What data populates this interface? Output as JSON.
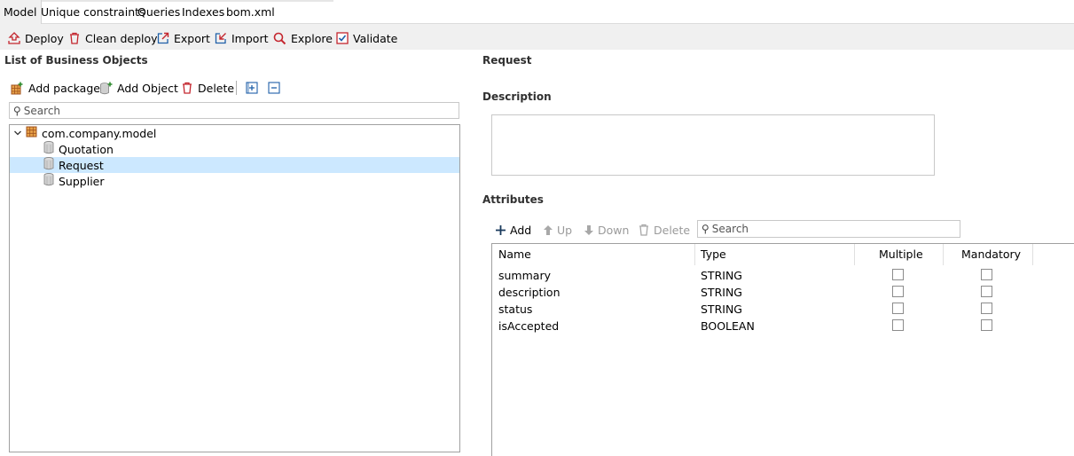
{
  "tabs": [
    {
      "label": "Model",
      "active": true
    },
    {
      "label": "Unique constraints",
      "active": false
    },
    {
      "label": "Queries",
      "active": false
    },
    {
      "label": "Indexes",
      "active": false
    },
    {
      "label": "bom.xml",
      "active": false
    }
  ],
  "toolbar": {
    "deploy": "Deploy",
    "clean_deploy": "Clean deploy",
    "export": "Export",
    "import": "Import",
    "explore": "Explore",
    "validate": "Validate"
  },
  "left_panel": {
    "title": "List of Business Objects",
    "add_package": "Add package",
    "add_object": "Add Object",
    "delete": "Delete",
    "search_placeholder": "Search",
    "tree": {
      "package": "com.company.model",
      "objects": [
        "Quotation",
        "Request",
        "Supplier"
      ],
      "selected": "Request"
    }
  },
  "right_panel": {
    "object_name": "Request",
    "description_label": "Description",
    "description_value": "",
    "attributes_label": "Attributes",
    "buttons": {
      "add": "Add",
      "up": "Up",
      "down": "Down",
      "delete": "Delete"
    },
    "search_placeholder": "Search",
    "columns": [
      "Name",
      "Type",
      "Multiple",
      "Mandatory"
    ],
    "rows": [
      {
        "name": "summary",
        "type": "STRING",
        "multiple": false,
        "mandatory": false
      },
      {
        "name": "description",
        "type": "STRING",
        "multiple": false,
        "mandatory": false
      },
      {
        "name": "status",
        "type": "STRING",
        "multiple": false,
        "mandatory": false
      },
      {
        "name": "isAccepted",
        "type": "BOOLEAN",
        "multiple": false,
        "mandatory": false
      }
    ]
  },
  "colors": {
    "accent_red": "#c4262e",
    "accent_blue": "#1f5fa8",
    "selection": "#cce8ff"
  }
}
